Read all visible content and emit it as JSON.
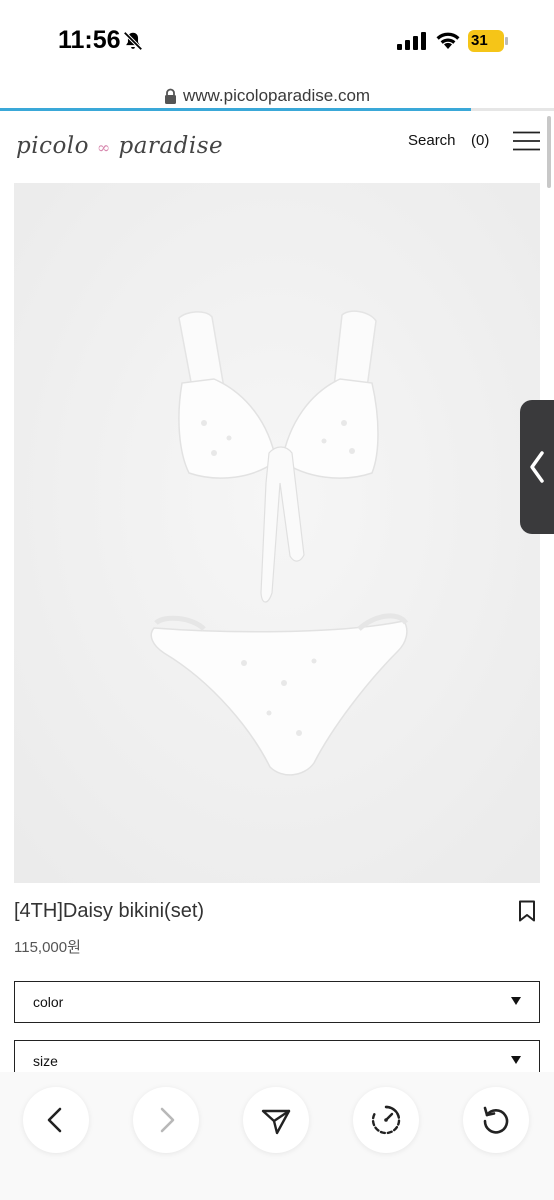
{
  "status_bar": {
    "time": "11:56",
    "battery_level": "31",
    "battery_color": "#f5c518"
  },
  "browser": {
    "url": "www.picoloparadise.com",
    "load_progress": 0.85,
    "progress_color": "#3aa8d8"
  },
  "site_header": {
    "logo_left": "picolo",
    "logo_right": "paradise",
    "search_label": "Search",
    "cart_label": "(0)",
    "menu_icon": "hamburger-menu-icon"
  },
  "product": {
    "title": "[4TH]Daisy bikini(set)",
    "price": "115,000원",
    "image_icon": "white-bikini-photo"
  },
  "options": [
    {
      "label": "color"
    },
    {
      "label": "size"
    }
  ],
  "toolbar": {
    "icons": [
      "back-arrow-icon",
      "forward-arrow-icon",
      "share-icon",
      "speed-dial-icon",
      "reload-icon"
    ]
  }
}
